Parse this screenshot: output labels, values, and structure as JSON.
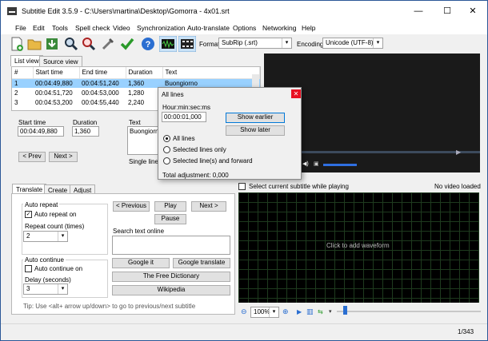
{
  "window": {
    "title": "Subtitle Edit 3.5.9 - C:\\Users\\martina\\Desktop\\Gomorra - 4x01.srt",
    "minimize": "—",
    "maximize": "☐",
    "close": "✕"
  },
  "menu": [
    "File",
    "Edit",
    "Tools",
    "Spell check",
    "Video",
    "Synchronization",
    "Auto-translate",
    "Options",
    "Networking",
    "Help"
  ],
  "toolbar": {
    "format_label": "Format",
    "format_value": "SubRip (.srt)",
    "encoding_label": "Encoding",
    "encoding_value": "Unicode (UTF-8)"
  },
  "view_tabs": [
    "List view",
    "Source view"
  ],
  "subtitle_table": {
    "columns": [
      "#",
      "Start time",
      "End time",
      "Duration",
      "Text"
    ],
    "rows": [
      [
        "1",
        "00:04:49,880",
        "00:04:51,240",
        "1,360",
        "Buongiorno"
      ],
      [
        "2",
        "00:04:51,720",
        "00:04:53,000",
        "1,280",
        "Ve"
      ],
      [
        "3",
        "00:04:53,200",
        "00:04:55,440",
        "2,240",
        "Gr"
      ]
    ]
  },
  "editor": {
    "start_time_label": "Start time",
    "start_time_value": "00:04:49,880",
    "duration_label": "Duration",
    "duration_value": "1,360",
    "text_label": "Text",
    "text_value": "Buongiorn",
    "single_line_label": "Single line",
    "prev_button": "< Prev",
    "next_button": "Next >"
  },
  "translate_tabs": [
    "Translate",
    "Create",
    "Adjust"
  ],
  "translate": {
    "auto_repeat_group": "Auto repeat",
    "auto_repeat_on": "Auto repeat on",
    "repeat_count_label": "Repeat count (times)",
    "repeat_count_value": "2",
    "auto_continue_group": "Auto continue",
    "auto_continue_on": "Auto continue on",
    "delay_label": "Delay (seconds)",
    "delay_value": "3",
    "previous_button": "< Previous",
    "play_button": "Play",
    "next_button": "Next >",
    "pause_button": "Pause",
    "search_online_label": "Search text online",
    "google_it_button": "Google it",
    "google_translate_button": "Google translate",
    "free_dictionary_button": "The Free Dictionary",
    "wikipedia_button": "Wikipedia",
    "tip": "Tip: Use <alt+ arrow up/down> to go to previous/next subtitle"
  },
  "waveform": {
    "select_current_label": "Select current subtitle while playing",
    "no_video": "No video loaded",
    "click_to_add": "Click to add waveform",
    "zoom_value": "100%"
  },
  "dialog": {
    "title": "All lines",
    "time_format_label": "Hour:min:sec:ms",
    "time_value": "00:00:01,000",
    "show_earlier_button": "Show earlier",
    "show_later_button": "Show later",
    "all_lines": "All lines",
    "selected_lines_only": "Selected lines only",
    "selected_and_forward": "Selected line(s) and forward",
    "total_adjustment": "Total adjustment: 0,000"
  },
  "status": {
    "position": "1/343"
  }
}
